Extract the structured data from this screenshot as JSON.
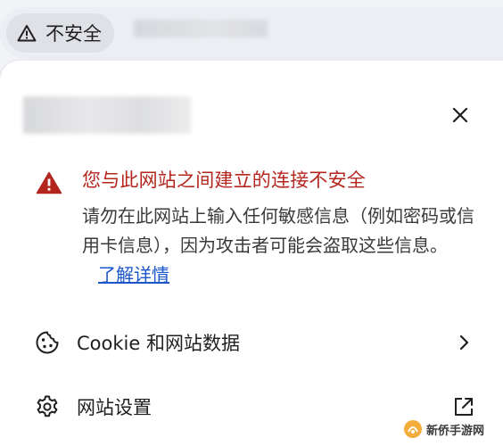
{
  "address_bar": {
    "security_chip_label": "不安全"
  },
  "popup": {
    "close_label": "×",
    "warning": {
      "title": "您与此网站之间建立的连接不安全",
      "body": "请勿在此网站上输入任何敏感信息（例如密码或信用卡信息），因为攻击者可能会盗取这些信息。",
      "learn_more": "了解详情"
    },
    "rows": [
      {
        "label": "Cookie 和网站数据",
        "icon": "cookie-icon",
        "trailing_icon": "chevron-right-icon"
      },
      {
        "label": "网站设置",
        "icon": "gear-icon",
        "trailing_icon": "open-external-icon"
      }
    ]
  },
  "watermark": {
    "text": "新侨手游网"
  },
  "colors": {
    "warning_red": "#b3261e",
    "link_blue": "#1a55c9",
    "chip_bg": "#dfe1e7",
    "bar_bg": "#eceef3"
  }
}
